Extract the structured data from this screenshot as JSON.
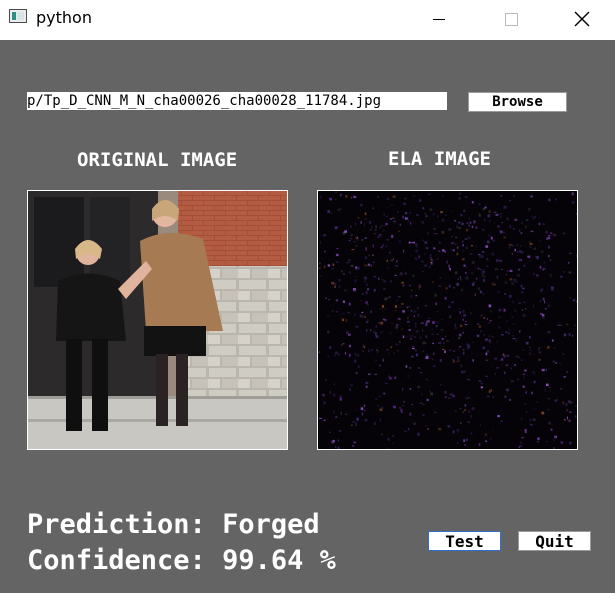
{
  "window": {
    "title": "python",
    "icon": "python-window-icon",
    "controls": [
      "minimize-icon",
      "maximize-icon",
      "close-icon"
    ]
  },
  "file": {
    "path": "p/Tp_D_CNN_M_N_cha00026_cha00028_11784.jpg",
    "browse_label": "Browse"
  },
  "panels": {
    "original_title": "ORIGINAL IMAGE",
    "ela_title": "ELA IMAGE"
  },
  "result": {
    "prediction": "Prediction: Forged",
    "confidence": "Confidence: 99.64 %"
  },
  "actions": {
    "test_label": "Test",
    "quit_label": "Quit"
  },
  "colors": {
    "background": "#646464",
    "text": "#ffffff",
    "button_bg": "#ffffff",
    "focus_border": "#2f6fd0"
  }
}
